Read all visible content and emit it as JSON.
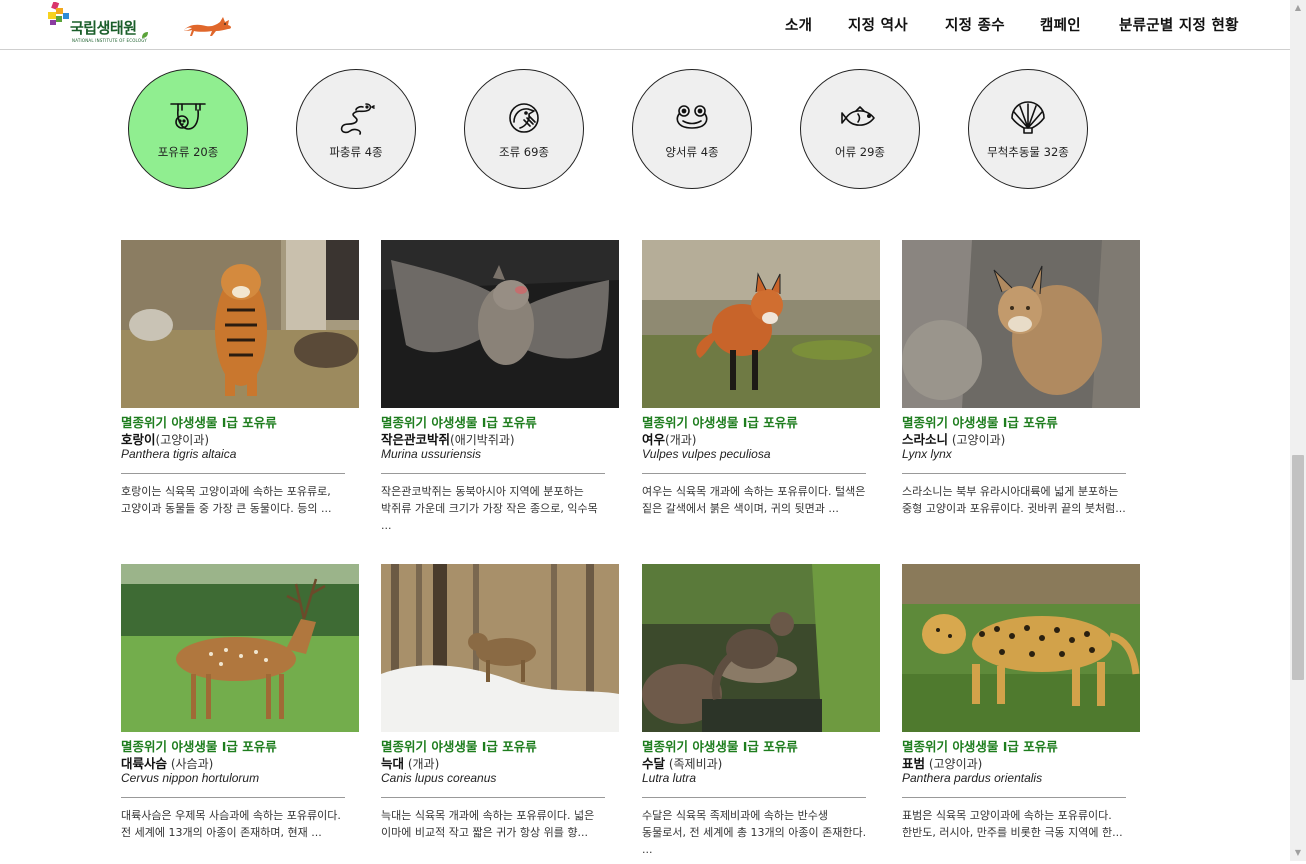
{
  "header": {
    "logo_text": "국립생태원",
    "logo_sub": "NATIONAL INSTITUTE OF ECOLOGY",
    "nav": [
      "소개",
      "지정 역사",
      "지정 종수",
      "캠페인",
      "분류군별 지정 현황"
    ]
  },
  "categories": [
    {
      "label": "포유류 20종",
      "icon": "sloth-icon",
      "active": true
    },
    {
      "label": "파충류 4종",
      "icon": "snake-icon",
      "active": false
    },
    {
      "label": "조류 69종",
      "icon": "bird-icon",
      "active": false
    },
    {
      "label": "양서류 4종",
      "icon": "frog-icon",
      "active": false
    },
    {
      "label": "어류 29종",
      "icon": "fish-icon",
      "active": false
    },
    {
      "label": "무척추동물 32종",
      "icon": "shell-icon",
      "active": false
    }
  ],
  "cards": [
    {
      "grade": "멸종위기 야생생물 Ⅰ급 포유류",
      "name": "호랑이",
      "family": "(고양이과)",
      "sci": "Panthera tigris altaica",
      "desc": "호랑이는 식육목 고양이과에 속하는 포유류로, 고양이과 동물들 중 가장 큰 동물이다. 등의 ..."
    },
    {
      "grade": "멸종위기 야생생물 Ⅰ급 포유류",
      "name": "작은관코박쥐",
      "family": "(애기박쥐과)",
      "sci": "Murina ussuriensis",
      "desc": "작은관코박쥐는 동북아시아 지역에 분포하는 박쥐류 가운데 크기가 가장 작은 종으로, 익수목 ..."
    },
    {
      "grade": "멸종위기 야생생물 Ⅰ급 포유류",
      "name": "여우",
      "family": "(개과)",
      "sci": "Vulpes vulpes peculiosa",
      "desc": "여우는 식육목 개과에 속하는 포유류이다. 털색은 짙은 갈색에서 붉은 색이며, 귀의 뒷면과 ..."
    },
    {
      "grade": "멸종위기 야생생물 Ⅰ급 포유류",
      "name": "스라소니",
      "family": " (고양이과)",
      "sci": "Lynx lynx",
      "desc": "스라소니는 북부 유라시아대륙에 넓게 분포하는 중형 고양이과 포유류이다. 귓바퀴 끝의 붓처럼..."
    },
    {
      "grade": "멸종위기 야생생물 Ⅰ급 포유류",
      "name": "대륙사슴",
      "family": " (사슴과)",
      "sci": "Cervus nippon hortulorum",
      "desc": "대륙사슴은 우제목 사슴과에 속하는 포유류이다. 전 세계에 13개의 아종이 존재하며, 현재 ..."
    },
    {
      "grade": "멸종위기 야생생물 Ⅰ급 포유류",
      "name": "늑대",
      "family": " (개과)",
      "sci": "Canis lupus coreanus",
      "desc": "늑대는 식육목 개과에 속하는 포유류이다. 넓은 이마에 비교적 작고 짧은 귀가 항상 위를 향..."
    },
    {
      "grade": "멸종위기 야생생물 Ⅰ급 포유류",
      "name": "수달",
      "family": " (족제비과)",
      "sci": "Lutra lutra",
      "desc": "수달은 식육목 족제비과에 속하는 반수생 동물로서, 전 세계에 총 13개의 아종이 존재한다. ..."
    },
    {
      "grade": "멸종위기 야생생물 Ⅰ급 포유류",
      "name": "표범",
      "family": " (고양이과)",
      "sci": "Panthera pardus orientalis",
      "desc": "표범은 식육목 고양이과에 속하는 포유류이다. 한반도, 러시아, 만주를 비롯한 극동 지역에 한..."
    }
  ],
  "colors": {
    "accent_green": "#1e7d1e",
    "active_circle": "#90ee90",
    "inactive_circle": "#efefef"
  }
}
